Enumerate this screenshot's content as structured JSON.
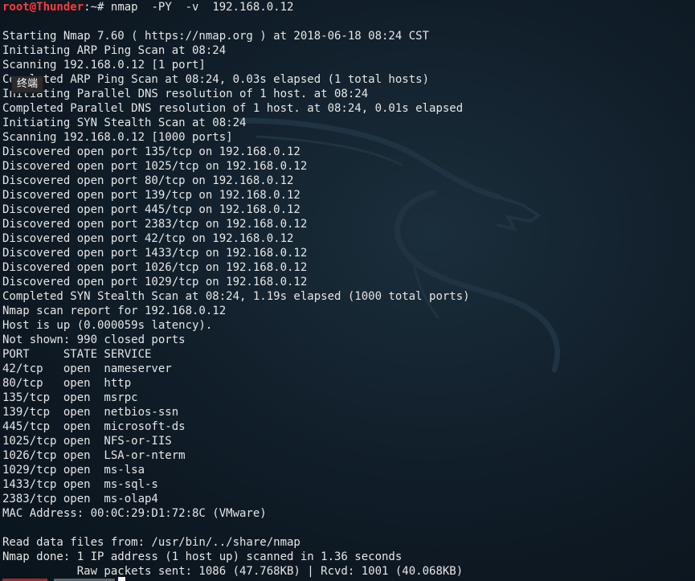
{
  "prompt": {
    "user": "root@Thunder",
    "separator": ":",
    "path": "~# ",
    "command": "nmap  -PY  -v  192.168.0.12"
  },
  "output_lines": [
    "",
    "Starting Nmap 7.60 ( https://nmap.org ) at 2018-06-18 08:24 CST",
    "Initiating ARP Ping Scan at 08:24",
    "Scanning 192.168.0.12 [1 port]",
    "Completed ARP Ping Scan at 08:24, 0.03s elapsed (1 total hosts)",
    "Initiating Parallel DNS resolution of 1 host. at 08:24",
    "Completed Parallel DNS resolution of 1 host. at 08:24, 0.01s elapsed",
    "Initiating SYN Stealth Scan at 08:24",
    "Scanning 192.168.0.12 [1000 ports]",
    "Discovered open port 135/tcp on 192.168.0.12",
    "Discovered open port 1025/tcp on 192.168.0.12",
    "Discovered open port 80/tcp on 192.168.0.12",
    "Discovered open port 139/tcp on 192.168.0.12",
    "Discovered open port 445/tcp on 192.168.0.12",
    "Discovered open port 2383/tcp on 192.168.0.12",
    "Discovered open port 42/tcp on 192.168.0.12",
    "Discovered open port 1433/tcp on 192.168.0.12",
    "Discovered open port 1026/tcp on 192.168.0.12",
    "Discovered open port 1029/tcp on 192.168.0.12",
    "Completed SYN Stealth Scan at 08:24, 1.19s elapsed (1000 total ports)",
    "Nmap scan report for 192.168.0.12",
    "Host is up (0.000059s latency).",
    "Not shown: 990 closed ports",
    "PORT     STATE SERVICE",
    "42/tcp   open  nameserver",
    "80/tcp   open  http",
    "135/tcp  open  msrpc",
    "139/tcp  open  netbios-ssn",
    "445/tcp  open  microsoft-ds",
    "1025/tcp open  NFS-or-IIS",
    "1026/tcp open  LSA-or-nterm",
    "1029/tcp open  ms-lsa",
    "1433/tcp open  ms-sql-s",
    "2383/tcp open  ms-olap4",
    "MAC Address: 00:0C:29:D1:72:8C (VMware)",
    "",
    "Read data files from: /usr/bin/../share/nmap",
    "Nmap done: 1 IP address (1 host up) scanned in 1.36 seconds",
    "           Raw packets sent: 1086 (47.768KB) | Rcvd: 1001 (40.068KB)"
  ],
  "tooltip": "终端",
  "colors": {
    "background": "#13222e",
    "text": "#e6e6e6",
    "prompt_user": "#ff3b3b"
  },
  "icons": {
    "background_logo": "kali-dragon-icon"
  }
}
